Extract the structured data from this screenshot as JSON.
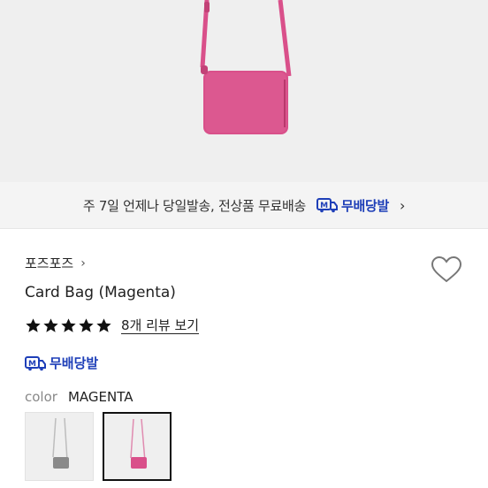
{
  "banner": {
    "text": "주 7일 언제나 당일발송, 전상품 무료배송",
    "badge_letter": "M",
    "badge_label": "무배당발",
    "chevron": "›"
  },
  "product": {
    "brand": "포즈포즈",
    "brand_chevron": "›",
    "title": "Card Bag (Magenta)",
    "rating_stars": 5,
    "review_link": "8개 리뷰 보기",
    "shipping_badge_letter": "M",
    "shipping_label": "무배당발",
    "color_label": "color",
    "color_value": "MAGENTA"
  },
  "colors": {
    "accent_blue": "#1e3fb8",
    "bag_magenta": "#d9508a",
    "bag_gray": "#8a8a8a"
  },
  "icons": [
    "heart-icon",
    "star-icon",
    "truck-m-icon",
    "chevron-right-icon"
  ]
}
